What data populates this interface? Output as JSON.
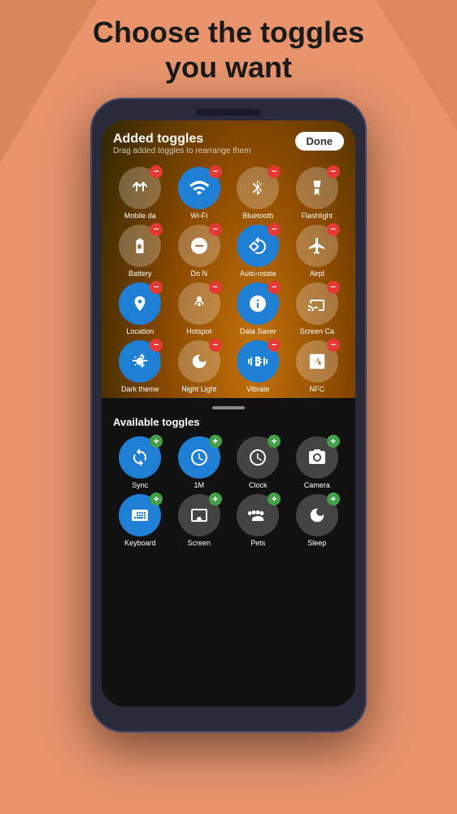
{
  "headline": {
    "line1": "Choose the toggles",
    "line2": "you want"
  },
  "added_section": {
    "title": "Added toggles",
    "subtitle": "Drag added toggles to rearrange them",
    "done_label": "Done"
  },
  "added_toggles": [
    {
      "id": "mobile-data",
      "label": "Mobile da",
      "icon": "↕",
      "active": false
    },
    {
      "id": "wifi",
      "label": "Wi-Fi",
      "icon": "wifi",
      "active": true
    },
    {
      "id": "bluetooth",
      "label": "Bluetooth",
      "icon": "bt",
      "active": false
    },
    {
      "id": "flashlight",
      "label": "Flashlight",
      "icon": "torch",
      "active": false
    },
    {
      "id": "power-saver",
      "label": "Battery",
      "icon": "battery",
      "active": false
    },
    {
      "id": "do-not-disturb",
      "label": "Do N",
      "icon": "⊖",
      "active": false
    },
    {
      "id": "auto-rotate",
      "label": "Auto-rotate",
      "icon": "rotate",
      "active": true
    },
    {
      "id": "airplane",
      "label": "Airpl",
      "icon": "✈",
      "active": false
    },
    {
      "id": "location",
      "label": "Location",
      "icon": "loc",
      "active": true
    },
    {
      "id": "hotspot",
      "label": "Hotspot",
      "icon": "hotspot",
      "active": false
    },
    {
      "id": "data-saver",
      "label": "Data Saver",
      "icon": "datasaver",
      "active": true
    },
    {
      "id": "screen-cast",
      "label": "Screen Ca",
      "icon": "cast",
      "active": false
    },
    {
      "id": "dark-theme",
      "label": "Dark theme",
      "icon": "darktheme",
      "active": true
    },
    {
      "id": "night-light",
      "label": "Night Light",
      "icon": "nightlight",
      "active": false
    },
    {
      "id": "vibrate",
      "label": "Vibrate",
      "icon": "vibrate",
      "active": true
    },
    {
      "id": "nfc",
      "label": "NFC",
      "icon": "nfc",
      "active": false
    }
  ],
  "available_section": {
    "title": "Available toggles"
  },
  "available_toggles": [
    {
      "id": "sync",
      "label": "Sync",
      "icon": "sync",
      "blue": true
    },
    {
      "id": "1m",
      "label": "1M",
      "icon": "clock-alt",
      "blue": true
    },
    {
      "id": "clock",
      "label": "Clock",
      "icon": "clock",
      "blue": false
    },
    {
      "id": "camera",
      "label": "Camera",
      "icon": "camera",
      "blue": false
    },
    {
      "id": "keyboard",
      "label": "Keyboard",
      "icon": "keyboard",
      "blue": true
    },
    {
      "id": "screen-rec",
      "label": "Screen",
      "icon": "screen",
      "blue": false
    },
    {
      "id": "paw",
      "label": "Pets",
      "icon": "paw",
      "blue": false
    },
    {
      "id": "sleep",
      "label": "Sleep",
      "icon": "sleep",
      "blue": false
    }
  ]
}
